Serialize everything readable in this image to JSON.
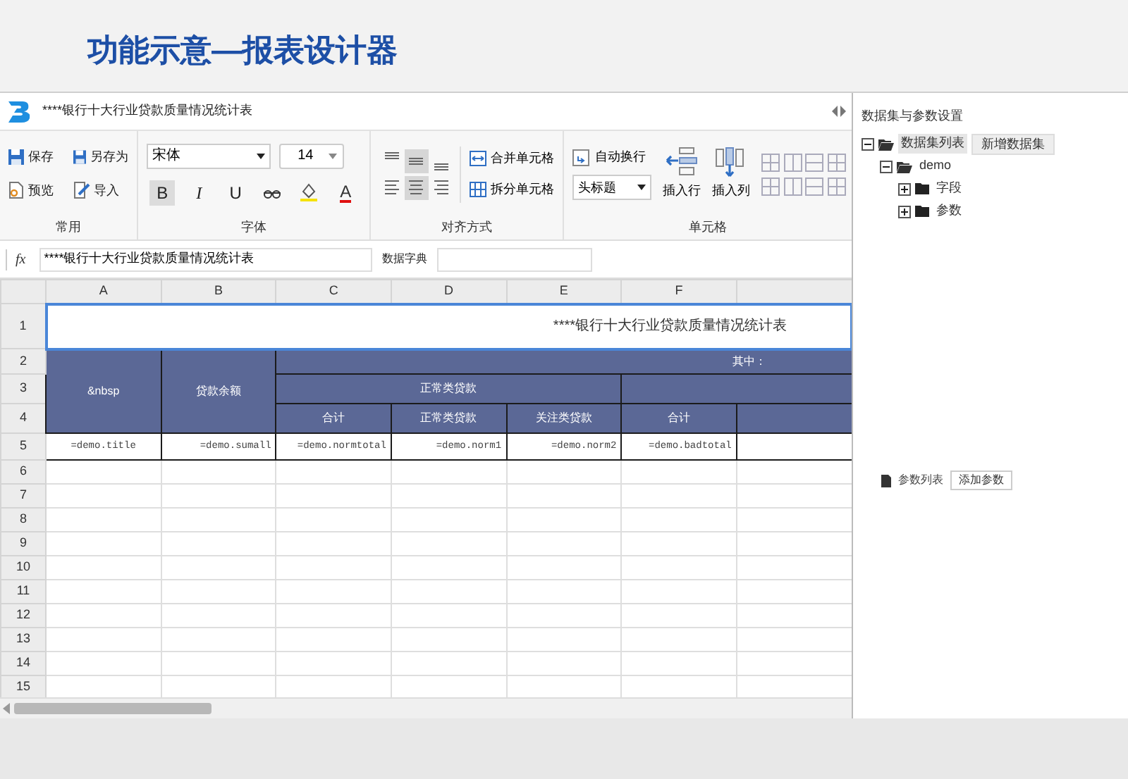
{
  "slide_title": "功能示意—报表设计器",
  "app": {
    "title": "****银行十大行业贷款质量情况统计表"
  },
  "ribbon": {
    "common": {
      "label": "常用",
      "buttons": [
        {
          "kind": "save",
          "label": "保存"
        },
        {
          "kind": "save_as",
          "label": "另存为"
        },
        {
          "kind": "preview",
          "label": "预览"
        },
        {
          "kind": "import",
          "label": "导入"
        }
      ]
    },
    "font": {
      "label": "字体",
      "family": "宋体",
      "size": "14",
      "buttons": [
        {
          "kind": "bold",
          "label": "B",
          "selected": true
        },
        {
          "kind": "italic",
          "label": "I",
          "selected": false
        },
        {
          "kind": "underline",
          "label": "U",
          "selected": false
        },
        {
          "kind": "strike",
          "selected": false
        },
        {
          "kind": "fill",
          "selected": false
        },
        {
          "kind": "color",
          "label": "A",
          "selected": false
        }
      ]
    },
    "align": {
      "label": "对齐方式",
      "buttons": [
        {
          "selected": false
        },
        {
          "selected": true
        },
        {
          "selected": false
        },
        {
          "selected": false
        },
        {
          "selected": true
        },
        {
          "selected": false
        }
      ],
      "merge": "合并单元格",
      "split": "拆分单元格"
    },
    "cell": {
      "label": "单元格",
      "wrap": "自动换行",
      "style": "头标题",
      "insert_row": "插入行",
      "insert_col": "插入列"
    }
  },
  "formula_bar": {
    "fx": "fx",
    "value": "****银行十大行业贷款质量情况统计表",
    "dict_label": "数据字典"
  },
  "sheet": {
    "columns": [
      "A",
      "B",
      "C",
      "D",
      "E",
      "F"
    ],
    "rows": [
      "1",
      "2",
      "3",
      "4",
      "5",
      "6",
      "7",
      "8",
      "9",
      "10",
      "11",
      "12",
      "13",
      "14",
      "15"
    ],
    "title": "****银行十大行业贷款质量情况统计表",
    "header": {
      "col_a": "&nbsp",
      "col_b": "贷款余额",
      "group": "其中：",
      "sub_group": "正常类贷款",
      "sub_columns": [
        "合计",
        "正常类贷款",
        "关注类贷款",
        "合计"
      ]
    },
    "data_row": [
      "=demo.title",
      "=demo.sumall",
      "=demo.normtotal",
      "=demo.norm1",
      "=demo.norm2",
      "=demo.badtotal"
    ]
  },
  "panel": {
    "title": "数据集与参数设置",
    "tree": [
      {
        "label": "数据集列表",
        "button": "新增数据集",
        "expanded": true,
        "selected": true,
        "children": [
          {
            "label": "demo",
            "expanded": true,
            "selected": false,
            "children": [
              {
                "label": "字段",
                "expanded": false,
                "selected": false
              },
              {
                "label": "参数",
                "expanded": false,
                "selected": false
              }
            ]
          }
        ]
      }
    ],
    "params": {
      "label": "参数列表",
      "button": "添加参数"
    }
  }
}
